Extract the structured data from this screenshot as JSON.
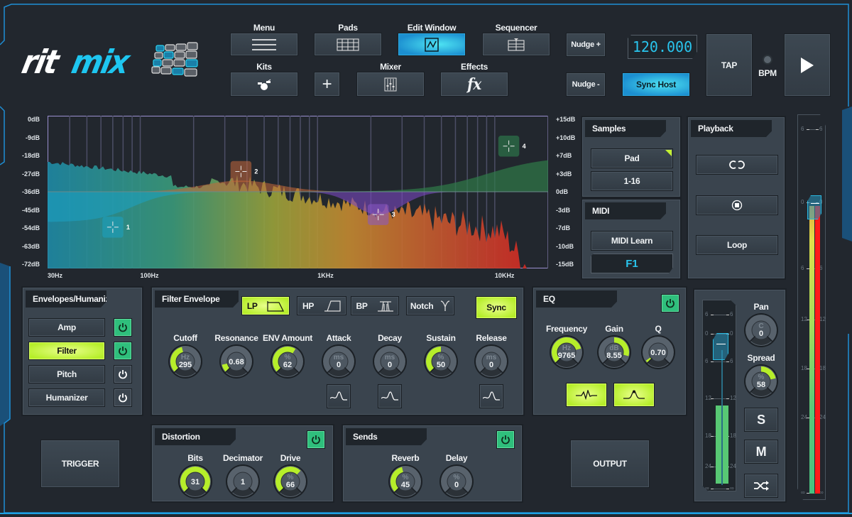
{
  "app": {
    "name_left": "rit",
    "name_right": "mix"
  },
  "toolbar": {
    "menu": "Menu",
    "pads": "Pads",
    "edit_window": "Edit Window",
    "sequencer": "Sequencer",
    "kits": "Kits",
    "mixer": "Mixer",
    "effects": "Effects",
    "effects_glyph": "fx",
    "add_glyph": "+",
    "nudge_plus": "Nudge +",
    "nudge_minus": "Nudge -",
    "bpm_value": "120.000",
    "sync_host": "Sync Host",
    "tap": "TAP",
    "bpm_label": "BPM",
    "active": "Edit Window"
  },
  "colors": {
    "accent_blue": "#1fa6e0",
    "lime": "#b6ee2a",
    "power_on": "#2fbf7c",
    "meter_red": "#ff1a1a"
  },
  "spectrum": {
    "left_axis": [
      "0dB",
      "-9dB",
      "-18dB",
      "-27dB",
      "-36dB",
      "-45dB",
      "-54dB",
      "-63dB",
      "-72dB"
    ],
    "right_axis": [
      "+15dB",
      "+10dB",
      "+7dB",
      "+3dB",
      "0dB",
      "-3dB",
      "-7dB",
      "-10dB",
      "-15dB"
    ],
    "bottom_axis": [
      {
        "label": "30Hz",
        "hz": 30
      },
      {
        "label": "100Hz",
        "hz": 100
      },
      {
        "label": "1KHz",
        "hz": 1000
      },
      {
        "label": "10KHz",
        "hz": 10000
      }
    ],
    "eq_nodes": [
      {
        "id": "1",
        "color": "#1ba3c4",
        "hz": 70,
        "db": -7
      },
      {
        "id": "2",
        "color": "#c7683b",
        "hz": 370,
        "db": 4
      },
      {
        "id": "3",
        "color": "#8a58c8",
        "hz": 2200,
        "db": -4.5
      },
      {
        "id": "4",
        "color": "#2f8a52",
        "hz": 12000,
        "db": 9
      }
    ]
  },
  "samples": {
    "title": "Samples",
    "pad": "Pad",
    "range": "1-16"
  },
  "midi": {
    "title": "MIDI",
    "learn": "MIDI Learn",
    "note": "F1"
  },
  "playback": {
    "title": "Playback",
    "loop": "Loop"
  },
  "envelopes": {
    "title": "Envelopes/Humanizer",
    "items": [
      {
        "label": "Amp",
        "active": false,
        "power": true
      },
      {
        "label": "Filter",
        "active": true,
        "power": true
      },
      {
        "label": "Pitch",
        "active": false,
        "power": false
      },
      {
        "label": "Humanizer",
        "active": false,
        "power": false
      }
    ]
  },
  "filter_env": {
    "title": "Filter Envelope",
    "types": [
      {
        "label": "LP",
        "active": true
      },
      {
        "label": "HP",
        "active": false
      },
      {
        "label": "BP",
        "active": false
      },
      {
        "label": "Notch",
        "active": false
      }
    ],
    "sync": "Sync",
    "knobs": [
      {
        "label": "Cutoff",
        "unit": "Hz",
        "value": "295",
        "fill": 0.45
      },
      {
        "label": "Resonance",
        "unit": "",
        "value": "0.68",
        "fill": 0.12
      },
      {
        "label": "ENV Amount",
        "unit": "%",
        "value": "62",
        "fill": 0.62
      },
      {
        "label": "Attack",
        "unit": "ms",
        "value": "0",
        "fill": 0
      },
      {
        "label": "Decay",
        "unit": "ms",
        "value": "0",
        "fill": 0
      },
      {
        "label": "Sustain",
        "unit": "%",
        "value": "50",
        "fill": 0.5
      },
      {
        "label": "Release",
        "unit": "ms",
        "value": "0",
        "fill": 0
      }
    ]
  },
  "eq": {
    "title": "EQ",
    "power": true,
    "knobs": [
      {
        "label": "Frequency",
        "unit": "Hz",
        "value": "9765",
        "fill": 0.78
      },
      {
        "label": "Gain",
        "unit": "dB",
        "value": "8.55",
        "fill": 0.78,
        "bipolar": true
      },
      {
        "label": "Q",
        "unit": "",
        "value": "0.70",
        "fill": 0.04
      }
    ]
  },
  "distortion": {
    "title": "Distortion",
    "power": true,
    "knobs": [
      {
        "label": "Bits",
        "unit": "",
        "value": "31",
        "fill": 1.0
      },
      {
        "label": "Decimator",
        "unit": "",
        "value": "1",
        "fill": 0
      },
      {
        "label": "Drive",
        "unit": "%",
        "value": "66",
        "fill": 0.66
      }
    ]
  },
  "sends": {
    "title": "Sends",
    "power": true,
    "knobs": [
      {
        "label": "Reverb",
        "unit": "%",
        "value": "45",
        "fill": 0.45
      },
      {
        "label": "Delay",
        "unit": "%",
        "value": "0",
        "fill": 0
      }
    ]
  },
  "trigger": "TRIGGER",
  "output": "OUTPUT",
  "channel": {
    "pan": {
      "label": "Pan",
      "unit": "C",
      "value": "0",
      "fill": 0,
      "bipolar": true
    },
    "spread": {
      "label": "Spread",
      "unit": "%",
      "value": "58",
      "fill": 0.58,
      "bipolar": true
    },
    "solo": "S",
    "mute": "M",
    "meter_ticks": [
      "6",
      "0",
      "6",
      "12",
      "18",
      "24",
      "∞"
    ],
    "fader_db": 0,
    "level_fraction": 0.5
  },
  "master": {
    "meter_ticks": [
      "6",
      "0",
      "6",
      "12",
      "18",
      "24",
      "∞"
    ],
    "fader_db": 0,
    "left_level": 1.0,
    "right_level": 1.0
  }
}
